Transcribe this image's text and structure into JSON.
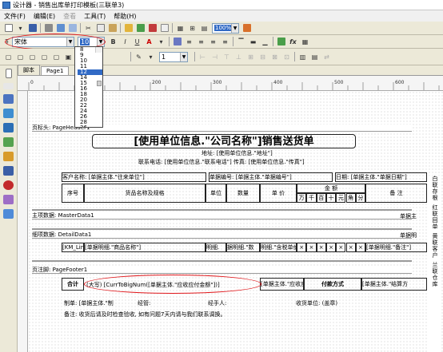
{
  "window": {
    "title": "设计器 - 销售出库单打印模板(三联单3)"
  },
  "menu": [
    {
      "label": "文件(F)"
    },
    {
      "label": "编辑(E)"
    },
    {
      "label": "查看"
    },
    {
      "label": "工具(T)"
    },
    {
      "label": "帮助(H)"
    }
  ],
  "toolbar": {
    "zoom": "100%"
  },
  "format_bar": {
    "font_name": "宋体",
    "font_size": "10",
    "bold": "B",
    "italic": "I",
    "underline": "U",
    "font_color": "A",
    "line_width": "1"
  },
  "font_size_options": [
    "8",
    "9",
    "10",
    "11",
    "12",
    "14",
    "15",
    "16",
    "18",
    "20",
    "22",
    "24",
    "26",
    "28",
    "36"
  ],
  "font_size_selected_index": 4,
  "tabs": [
    "脚本",
    "Page1"
  ],
  "ruler": {
    "marks": [
      "0",
      "25",
      "50",
      "75",
      "100",
      "125",
      "150",
      "175",
      "200",
      "225",
      "250",
      "275",
      "300",
      "325",
      "350",
      "375",
      "400",
      "425",
      "450",
      "475",
      "500",
      "525",
      "550",
      "575",
      "600",
      "625",
      "650",
      "675"
    ]
  },
  "report": {
    "page_header_band": "页标头: PageHeader1",
    "title": "[使用单位信息.\"公司名称\"]销售送货单",
    "address": "地址: [使用单位信息.\"地址\"]",
    "contact": "联系电话: [使用单位信息.\"联系电话\"]  传真: [使用单位信息.\"传真\"]",
    "customer": "客户名称: [单据主体.\"往来单位\"]",
    "bill_no": "单据编号: [单据主体.\"单据编号\"]",
    "date": "日期: [单据主体.\"单据日期\"]",
    "col_no": "序号",
    "col_name": "货品名称及规格",
    "col_unit": "单位",
    "col_qty": "数量",
    "col_price": "单 价",
    "col_amount": "金  额",
    "amount_digits": [
      "万",
      "千",
      "百",
      "十",
      "元",
      "角",
      "分"
    ],
    "col_note": "备  注",
    "master_band": "主项数据: MasterData1",
    "master_right": "单据主",
    "detail_band": "细项数据: DetailData1",
    "detail_right": "单据明",
    "detail_cells": [
      "[KM_Line]",
      "[单据明细.\"商品名称\"]",
      "明细.",
      "据明细.\"数",
      "明细.\"含税单价",
      "[单据明细.\"备注\"]"
    ],
    "footer_band": "页注脚: PageFooter1",
    "total_label": "合计",
    "total_upper": "(大写) [CurrToBigNum([单据主体.\"应收应付金额\"])]",
    "total_amount": "[单据主体.\"应收应付",
    "pay_label": "付款方式",
    "pay_value": "[单据主体.\"结算方",
    "maker": "制单: [单据主体.\"制",
    "manager": "经管:",
    "handler": "经手人:",
    "receiver": "收货单位: (盖章)",
    "note": "备注: 收货后请及时检查验收, 如有问题7天内请与我们联系调换。",
    "side_labels": [
      "白联存根",
      "红联回单",
      "黄联客户",
      "兰联仓库"
    ]
  }
}
